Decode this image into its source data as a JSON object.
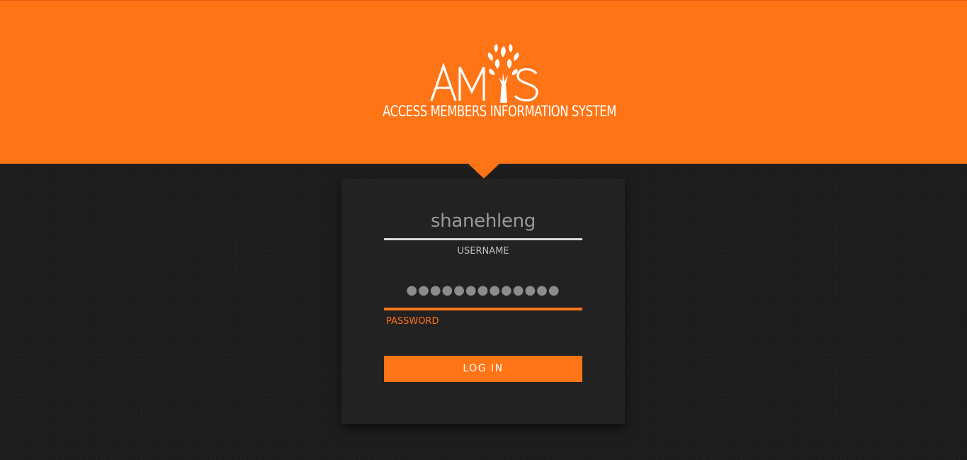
{
  "brand": {
    "logo_text": "AMIS",
    "tagline": "ACCESS MEMBERS INFORMATION SYSTEM"
  },
  "login_form": {
    "username": {
      "value": "shanehleng",
      "label": "USERNAME"
    },
    "password": {
      "masked_value": "●●●●●●●●●●●●●",
      "label": "PASSWORD",
      "focused": true
    },
    "submit_label": "LOG IN"
  },
  "colors": {
    "accent": "#ff7415",
    "background": "#1d1d1d",
    "card": "#222222",
    "inactive_underline": "#d9d9d9"
  },
  "icons": [
    "amis-tree-logo-icon"
  ]
}
